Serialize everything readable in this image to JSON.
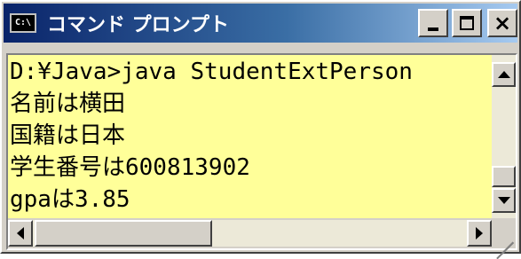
{
  "window": {
    "title": "コマンド プロンプト",
    "icon_text": "C:\\",
    "icon": "console-icon",
    "buttons": {
      "minimize": "minimize-icon",
      "maximize": "maximize-icon",
      "close_label": "×"
    }
  },
  "console": {
    "background": "#ffff99",
    "lines": [
      "D:¥Java>java StudentExtPerson",
      "名前は横田",
      "国籍は日本",
      "学生番号は600813902",
      "gpaは3.85"
    ]
  },
  "colors": {
    "titlebar_start": "#0a246a",
    "titlebar_end": "#a6caf0",
    "chrome": "#d4d0c8"
  }
}
